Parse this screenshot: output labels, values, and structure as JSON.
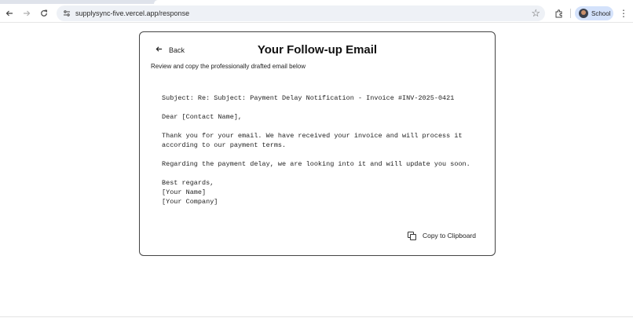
{
  "browser": {
    "url": "supplysync-five.vercel.app/response",
    "profile_label": "School"
  },
  "card": {
    "back_label": "Back",
    "title": "Your Follow-up Email",
    "subtitle": "Review and copy the professionally drafted email below",
    "copy_label": "Copy to Clipboard"
  },
  "email": {
    "subject": "Subject: Re: Subject: Payment Delay Notification - Invoice #INV-2025-0421",
    "greeting": "Dear [Contact Name],",
    "paragraph1": "Thank you for your email. We have received your invoice and will process it\naccording to our payment terms.",
    "paragraph2": "Regarding the payment delay, we are looking into it and will update you soon.",
    "closing": "Best regards,",
    "signature_name": "[Your Name]",
    "signature_company": "[Your Company]"
  }
}
